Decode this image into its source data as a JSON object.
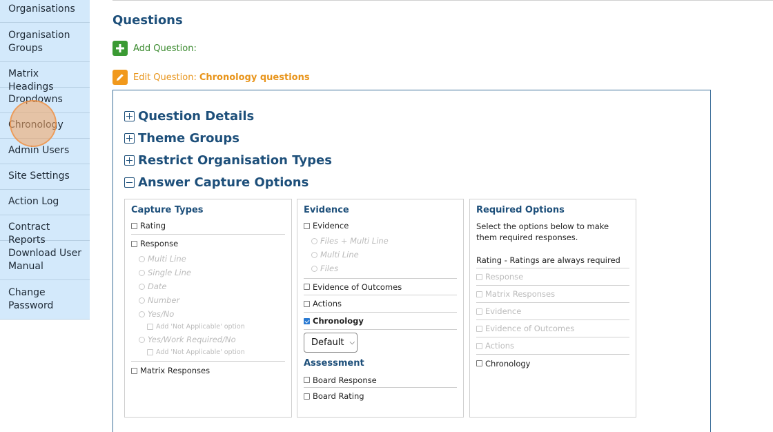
{
  "sidebar": {
    "items": [
      {
        "label": "Organisations"
      },
      {
        "label": "Organisation Groups"
      },
      {
        "label": "Matrix Headings"
      },
      {
        "label": "Dropdowns"
      },
      {
        "label": "Chronology"
      },
      {
        "label": "Admin Users"
      },
      {
        "label": "Site Settings"
      },
      {
        "label": "Action Log"
      },
      {
        "label": "Contract Reports"
      },
      {
        "label": "Download User Manual"
      },
      {
        "label": "Change Password"
      }
    ]
  },
  "main": {
    "title": "Questions",
    "add_label": "Add Question:",
    "edit_label": "Edit Question:",
    "edit_name": "Chronology questions",
    "sections": {
      "question_details": "Question Details",
      "theme_groups": "Theme Groups",
      "restrict_org_types": "Restrict Organisation Types",
      "answer_capture": "Answer Capture Options"
    },
    "capture_types": {
      "title": "Capture Types",
      "rating": "Rating",
      "response": "Response",
      "multi_line": "Multi Line",
      "single_line": "Single Line",
      "date": "Date",
      "number": "Number",
      "yes_no": "Yes/No",
      "add_na_1": "Add 'Not Applicable' option",
      "yes_work": "Yes/Work Required/No",
      "add_na_2": "Add 'Not Applicable' option",
      "matrix_responses": "Matrix Responses"
    },
    "evidence": {
      "title": "Evidence",
      "evidence": "Evidence",
      "files_multi": "Files + Multi Line",
      "multi_line": "Multi Line",
      "files": "Files",
      "evidence_outcomes": "Evidence of Outcomes",
      "actions": "Actions",
      "chronology": "Chronology",
      "chronology_select": "Default",
      "assessment_title": "Assessment",
      "board_response": "Board Response",
      "board_rating": "Board Rating"
    },
    "required": {
      "title": "Required Options",
      "desc": "Select the options below to make them required responses.",
      "rating_note": "Rating - Ratings are always required",
      "response": "Response",
      "matrix_responses": "Matrix Responses",
      "evidence": "Evidence",
      "evidence_outcomes": "Evidence of Outcomes",
      "actions": "Actions",
      "chronology": "Chronology"
    }
  },
  "colors": {
    "sidebar_bg": "#d3e9fb",
    "heading": "#1d4f7a",
    "add_green": "#3a9a33",
    "edit_orange": "#f1991c"
  }
}
